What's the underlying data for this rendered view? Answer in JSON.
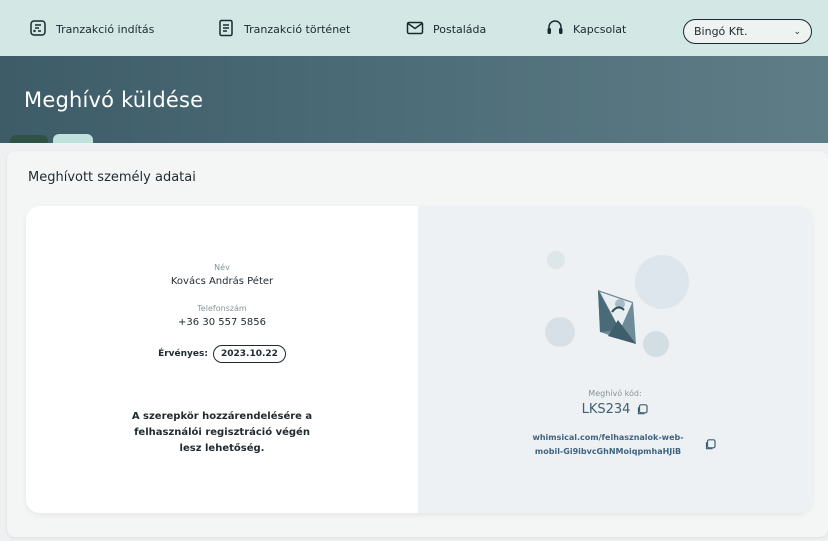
{
  "nav": {
    "items": [
      {
        "label": "Tranzakció indítás",
        "icon": "transaction-start-icon"
      },
      {
        "label": "Tranzakció történet",
        "icon": "document-icon"
      },
      {
        "label": "Postaláda",
        "icon": "mail-icon"
      },
      {
        "label": "Kapcsolat",
        "icon": "headset-icon"
      }
    ],
    "company_select": {
      "value": "Bingó Kft.",
      "icon": "chevron-down-icon"
    }
  },
  "header": {
    "title": "Meghívó küldése"
  },
  "section": {
    "title": "Meghívott személy adatai"
  },
  "person": {
    "name_label": "Név",
    "name": "Kovács András Péter",
    "phone_label": "Telefonszám",
    "phone": "+36 30 557 5856",
    "validity_label": "Érvényes:",
    "validity_date": "2023.10.22",
    "note": "A szerepkör hozzárendelésére a felhasználói regisztráció végén lesz lehetőség."
  },
  "invite": {
    "code_label": "Meghívó kód:",
    "code": "LKS234",
    "link": "whimsical.com/felhasznalok-web-mobil-Gi9ibvcGhNMoiqpmhaHJiB"
  },
  "colors": {
    "nav_bg": "#d3e7e5",
    "header_bg": "#4d6d78",
    "accent_dark": "#2f5246",
    "accent_light": "#bfe3dc",
    "link": "#3f6480"
  }
}
